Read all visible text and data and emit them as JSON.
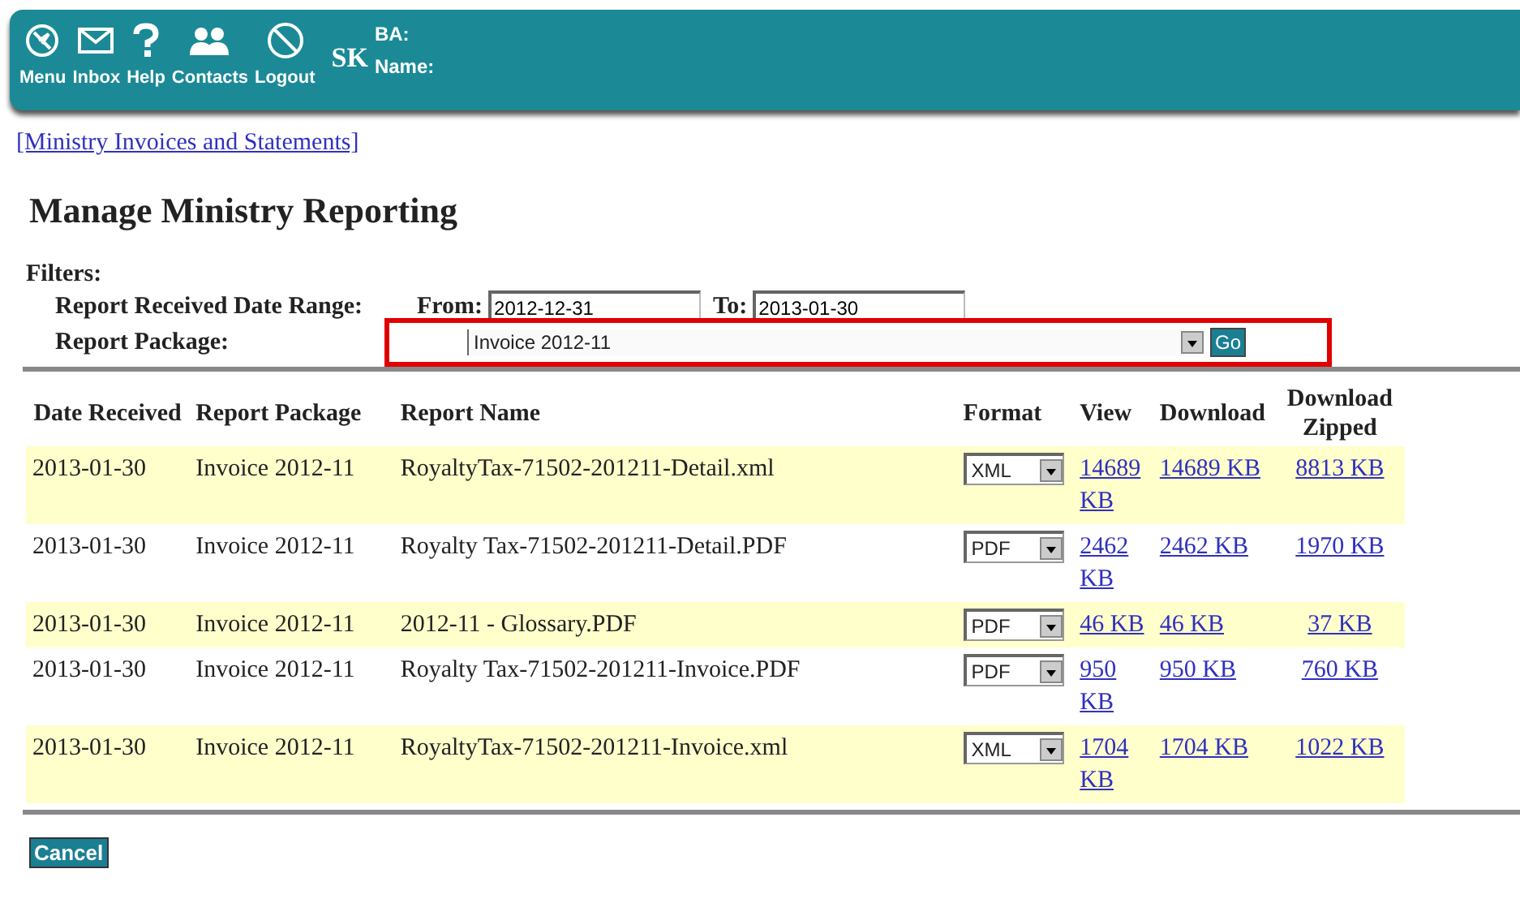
{
  "top_bar": {
    "nav": [
      {
        "label": "Menu",
        "kind": "menu"
      },
      {
        "label": "Inbox",
        "kind": "inbox"
      },
      {
        "label": "Help",
        "kind": "help"
      },
      {
        "label": "Contacts",
        "kind": "contacts"
      },
      {
        "label": "Logout",
        "kind": "logout"
      }
    ],
    "province": "SK",
    "ba_label": "BA:",
    "name_label": "Name:"
  },
  "breadcrumb": "[Ministry Invoices and Statements]",
  "title": "Manage Ministry Reporting",
  "filters": {
    "heading": "Filters:",
    "date_range_label": "Report Received Date Range:",
    "from_label": "From:",
    "from_value": "2012-12-31",
    "to_label": "To:",
    "to_value": "2013-01-30",
    "package_label": "Report Package:",
    "package_value": "Invoice 2012-11",
    "package_highlighted": true,
    "go": "Go"
  },
  "table": {
    "columns": [
      "Date Received",
      "Report Package",
      "Report Name",
      "Format",
      "View",
      "Download",
      "Download Zipped"
    ],
    "rows": [
      {
        "date": "2013-01-30",
        "package": "Invoice 2012-11",
        "name": "RoyaltyTax-71502-201211-Detail.xml",
        "format": "XML",
        "view": "14689 KB",
        "download": "14689 KB",
        "zipped": "8813 KB"
      },
      {
        "date": "2013-01-30",
        "package": "Invoice 2012-11",
        "name": "Royalty Tax-71502-201211-Detail.PDF",
        "format": "PDF",
        "view": "2462 KB",
        "download": "2462 KB",
        "zipped": "1970 KB"
      },
      {
        "date": "2013-01-30",
        "package": "Invoice 2012-11",
        "name": "2012-11 - Glossary.PDF",
        "format": "PDF",
        "view": "46 KB",
        "download": "46 KB",
        "zipped": "37 KB"
      },
      {
        "date": "2013-01-30",
        "package": "Invoice 2012-11",
        "name": "Royalty Tax-71502-201211-Invoice.PDF",
        "format": "PDF",
        "view": "950 KB",
        "download": "950 KB",
        "zipped": "760 KB"
      },
      {
        "date": "2013-01-30",
        "package": "Invoice 2012-11",
        "name": "RoyaltyTax-71502-201211-Invoice.xml",
        "format": "XML",
        "view": "1704 KB",
        "download": "1704 KB",
        "zipped": "1022 KB"
      }
    ]
  },
  "cancel": "Cancel"
}
